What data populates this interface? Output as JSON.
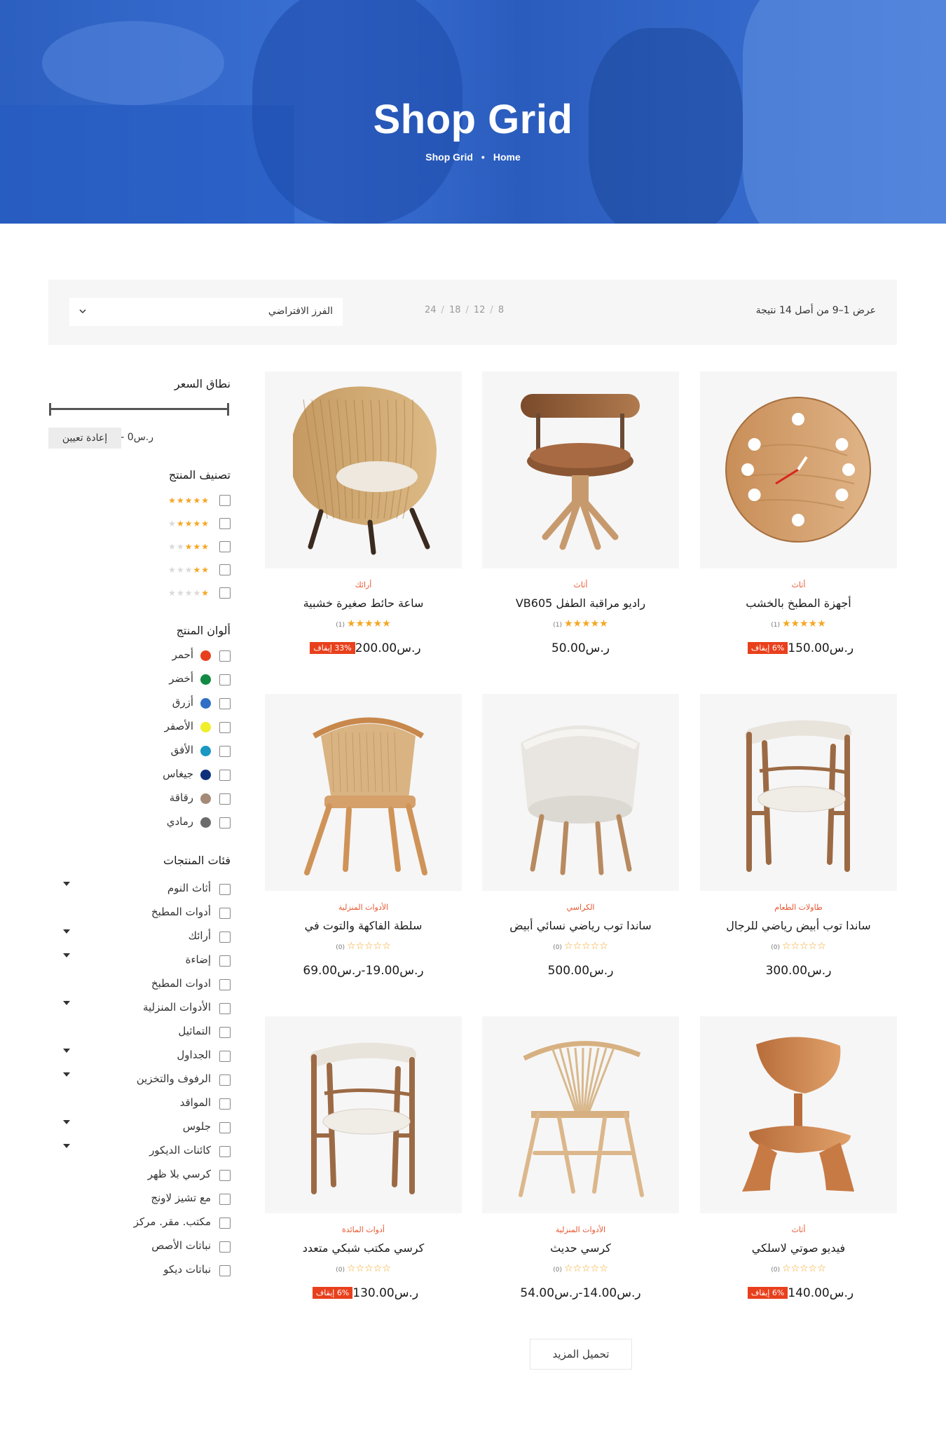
{
  "hero": {
    "title": "Shop Grid",
    "crumb_home": "Home",
    "crumb_current": "Shop Grid",
    "crumb_sep": "•"
  },
  "toolbar": {
    "results": "عرض 1–9 من أصل 14 نتيجة",
    "per_page": [
      "8",
      "12",
      "18",
      "24"
    ],
    "sort_label": "الفرز الافتراضي"
  },
  "sidebar": {
    "price_title": "نطاق السعر",
    "price_value": "ر.س0 - ر.س1000",
    "reset_label": "إعادة تعيين",
    "rating_title": "تصنيف المنتج",
    "ratings": [
      5,
      4,
      3,
      2,
      1
    ],
    "colors_title": "ألوان المنتج",
    "colors": [
      {
        "label": "أحمر",
        "hex": "#e8401c"
      },
      {
        "label": "أخضر",
        "hex": "#138a43"
      },
      {
        "label": "أزرق",
        "hex": "#2f6fc6"
      },
      {
        "label": "الأصفر",
        "hex": "#f1ee2a"
      },
      {
        "label": "الأفق",
        "hex": "#1a97c2"
      },
      {
        "label": "جيغاس",
        "hex": "#0e2f7a"
      },
      {
        "label": "رقاقة",
        "hex": "#a58a78"
      },
      {
        "label": "رمادي",
        "hex": "#6b6b6b"
      }
    ],
    "categories_title": "فئات المنتجات",
    "categories": [
      {
        "label": "أثاث النوم",
        "expandable": true
      },
      {
        "label": "أدوات المطبخ",
        "expandable": false
      },
      {
        "label": "أرائك",
        "expandable": true
      },
      {
        "label": "إضاءة",
        "expandable": true
      },
      {
        "label": "ادوات المطبخ",
        "expandable": false
      },
      {
        "label": "الأدوات المنزلية",
        "expandable": true
      },
      {
        "label": "التماثيل",
        "expandable": false
      },
      {
        "label": "الجداول",
        "expandable": true
      },
      {
        "label": "الرفوف والتخزين",
        "expandable": true
      },
      {
        "label": "المواقد",
        "expandable": false
      },
      {
        "label": "جلوس",
        "expandable": true
      },
      {
        "label": "كائنات الديكور",
        "expandable": true
      },
      {
        "label": "كرسي بلا ظهر",
        "expandable": false
      },
      {
        "label": "مع تشيز لاونج",
        "expandable": false
      },
      {
        "label": "مكتب. مقر. مركز",
        "expandable": false
      },
      {
        "label": "نباتات الأصص",
        "expandable": false
      },
      {
        "label": "نباتات ديكو",
        "expandable": false
      }
    ]
  },
  "products": [
    {
      "category": "أثاث",
      "name": "أجهزة المطبخ بالخشب",
      "rating": 5,
      "count": "(1)",
      "price": "ر.س150.00",
      "badge": "6% إيقاف",
      "image": "wall-clock"
    },
    {
      "category": "أثاث",
      "name": "راديو مراقبة الطفل VB605",
      "rating": 5,
      "count": "(1)",
      "price": "ر.س50.00",
      "badge": "",
      "image": "swivel-chair"
    },
    {
      "category": "أرائك",
      "name": "ساعة حائط صغيرة خشبية",
      "rating": 5,
      "count": "(1)",
      "price": "ر.س200.00",
      "badge": "33% إيقاف",
      "image": "wicker-chair"
    },
    {
      "category": "طاولات الطعام",
      "name": "ساندا توب أبيض رياضي للرجال",
      "rating": 0,
      "count": "(0)",
      "price": "ر.س300.00",
      "badge": "",
      "image": "armchair-white-seat"
    },
    {
      "category": "الكراسي",
      "name": "ساندا توب رياضي نسائي أبيض",
      "rating": 0,
      "count": "(0)",
      "price": "ر.س500.00",
      "badge": "",
      "image": "upholstered-tub-chair"
    },
    {
      "category": "الأدوات المنزلية",
      "name": "سلطة الفاكهة والتوت في",
      "rating": 0,
      "count": "(0)",
      "price": "ر.س19.00-ر.س69.00",
      "badge": "",
      "image": "rattan-chair"
    },
    {
      "category": "أثاث",
      "name": "فيديو صوتي لاسلكي",
      "rating": 0,
      "count": "(0)",
      "price": "ر.س140.00",
      "badge": "6% إيقاف",
      "image": "molded-plywood-chair"
    },
    {
      "category": "الأدوات المنزلية",
      "name": "كرسي حديث",
      "rating": 0,
      "count": "(0)",
      "price": "ر.س14.00-ر.س54.00",
      "badge": "",
      "image": "spindle-back-chair"
    },
    {
      "category": "أدوات المائدة",
      "name": "كرسي مكتب شبكي متعدد",
      "rating": 0,
      "count": "(0)",
      "price": "ر.س130.00",
      "badge": "6% إيقاف",
      "image": "armchair-white-seat"
    }
  ],
  "load_more": "تحميل المزيد",
  "colors": {
    "accent": "#e8401c",
    "star": "#f5a623",
    "hero_blue": "#2d64c8"
  }
}
